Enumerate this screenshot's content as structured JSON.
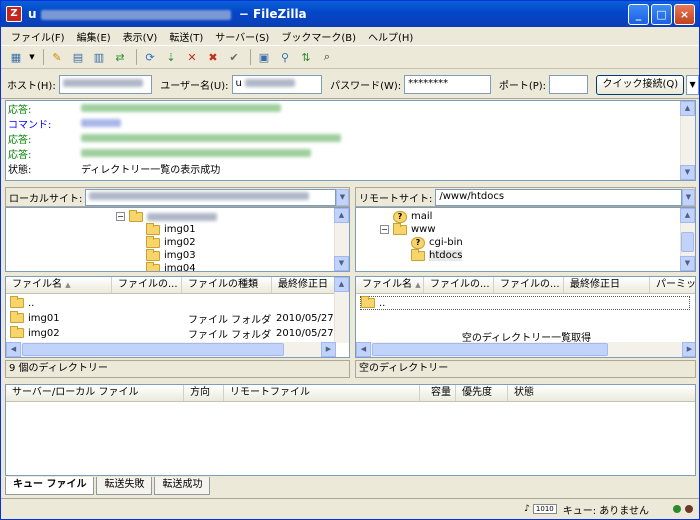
{
  "window": {
    "title_prefix": "u",
    "title_suffix": " − FileZilla"
  },
  "menu": [
    "ファイル(F)",
    "編集(E)",
    "表示(V)",
    "転送(T)",
    "サーバー(S)",
    "ブックマーク(B)",
    "ヘルプ(H)"
  ],
  "quickconnect": {
    "host_label": "ホスト(H):",
    "user_label": "ユーザー名(U):",
    "user_value": "u",
    "password_label": "パスワード(W):",
    "password_value": "********",
    "port_label": "ポート(P):",
    "port_value": "",
    "connect_label": "クイック接続(Q)"
  },
  "log": [
    {
      "tag": "応答:",
      "msg": ""
    },
    {
      "tag": "コマンド:",
      "msg": ""
    },
    {
      "tag": "応答:",
      "msg": ""
    },
    {
      "tag": "応答:",
      "msg": ""
    },
    {
      "tag": "状態:",
      "msg": "ディレクトリー一覧の表示成功"
    }
  ],
  "local": {
    "path_label": "ローカルサイト:",
    "tree": [
      "img01",
      "img02",
      "img03",
      "img04"
    ],
    "columns": [
      "ファイル名",
      "ファイルの...",
      "ファイルの種類",
      "最終修正日"
    ],
    "files": [
      {
        "name": "..",
        "size": "",
        "type": "",
        "date": ""
      },
      {
        "name": "img01",
        "size": "",
        "type": "ファイル フォルダ",
        "date": "2010/05/27"
      },
      {
        "name": "img02",
        "size": "",
        "type": "ファイル フォルダ",
        "date": "2010/05/27"
      }
    ],
    "status": "9 個のディレクトリー"
  },
  "remote": {
    "path_label": "リモートサイト:",
    "path_value": "/www/htdocs",
    "tree": {
      "mail": "mail",
      "www": "www",
      "cgibin": "cgi-bin",
      "htdocs": "htdocs"
    },
    "columns": [
      "ファイル名",
      "ファイルの...",
      "ファイルの...",
      "最終修正日",
      "パーミッ"
    ],
    "parent": "..",
    "empty_msg": "空のディレクトリー一覧取得",
    "status": "空のディレクトリー"
  },
  "queue": {
    "columns": [
      "サーバー/ローカル ファイル",
      "方向",
      "リモートファイル",
      "容量",
      "優先度",
      "状態"
    ],
    "tabs": [
      "キュー ファイル",
      "転送失敗",
      "転送成功"
    ]
  },
  "statusbar": {
    "queue_text": "キュー: ありません"
  },
  "colors": {
    "titlebar": "#0a5fd8",
    "chrome": "#ece9d8",
    "response": "#008000",
    "command": "#0000ff",
    "selection": "#c1d3fb"
  }
}
